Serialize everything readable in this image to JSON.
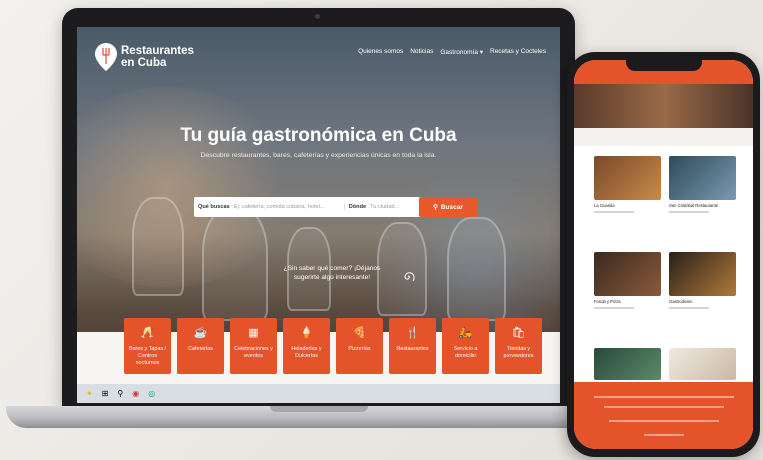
{
  "site": {
    "logo_line1": "Restaurantes",
    "logo_line2": "en Cuba",
    "nav": [
      "Quienes somos",
      "Noticias",
      "Gastronomía ▾",
      "Recetas y Cocteles"
    ],
    "hero_title": "Tu guía gastronómica en Cuba",
    "hero_subtitle": "Descubre restaurantes, bares, cafeterías y experiencias únicas en toda la isla.",
    "search": {
      "what_label": "Qué buscas",
      "what_placeholder": "Ej: cafetería, comida cubana, hotel...",
      "where_label": "Dónde",
      "where_placeholder": "Tu ciudad...",
      "button_label": "Buscar"
    },
    "prompt_line1": "¿Sin saber qué comer? ¡Déjanos",
    "prompt_line2": "sugerirte algo interesante!",
    "categories": [
      {
        "icon": "cocktail-icon",
        "glyph": "🥂",
        "label": "Bares y Tapas / Centros nocturnos"
      },
      {
        "icon": "coffee-icon",
        "glyph": "☕",
        "label": "Cafeterías"
      },
      {
        "icon": "calendar-icon",
        "glyph": "▦",
        "label": "Celebraciones y eventos"
      },
      {
        "icon": "icecream-icon",
        "glyph": "🍦",
        "label": "Heladerías y Dulcerías"
      },
      {
        "icon": "pizza-icon",
        "glyph": "🍕",
        "label": "Pizzerías"
      },
      {
        "icon": "cutlery-icon",
        "glyph": "🍴",
        "label": "Restaurantes"
      },
      {
        "icon": "scooter-icon",
        "glyph": "🛵",
        "label": "Servicio a domicilio"
      },
      {
        "icon": "shopping-bag-icon",
        "glyph": "🛍",
        "label": "Tiendas y proveedores"
      }
    ]
  },
  "phone": {
    "cards": [
      {
        "title": "La Guarida"
      },
      {
        "title": "San Cristóbal Restaurante"
      },
      {
        "title": "Fonda y Pizza"
      },
      {
        "title": "Gastrodivino"
      }
    ]
  },
  "colors": {
    "accent": "#e4532a"
  }
}
